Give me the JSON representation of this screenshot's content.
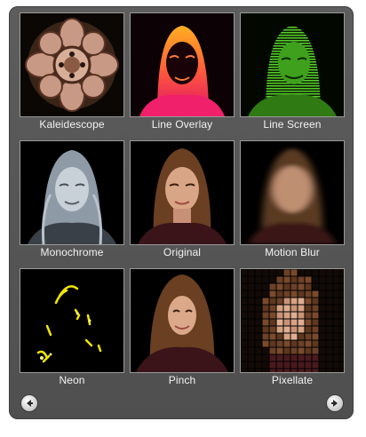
{
  "effects": [
    {
      "label": "Kaleidescope",
      "icon": "kaleidoscope-thumbnail",
      "selected": false
    },
    {
      "label": "Line Overlay",
      "icon": "line-overlay-thumbnail",
      "selected": false
    },
    {
      "label": "Line Screen",
      "icon": "line-screen-thumbnail",
      "selected": false
    },
    {
      "label": "Monochrome",
      "icon": "monochrome-thumbnail",
      "selected": false
    },
    {
      "label": "Original",
      "icon": "original-thumbnail",
      "selected": true
    },
    {
      "label": "Motion Blur",
      "icon": "motion-blur-thumbnail",
      "selected": false
    },
    {
      "label": "Neon",
      "icon": "neon-thumbnail",
      "selected": false
    },
    {
      "label": "Pinch",
      "icon": "pinch-thumbnail",
      "selected": false
    },
    {
      "label": "Pixellate",
      "icon": "pixellate-thumbnail",
      "selected": false
    }
  ],
  "navigation": {
    "previous_icon": "left-arrow-icon",
    "next_icon": "right-arrow-icon"
  },
  "colors": {
    "panel_background": "#555555",
    "label_text": "#f2f2f2",
    "thumb_border": "#9a9a9a"
  }
}
